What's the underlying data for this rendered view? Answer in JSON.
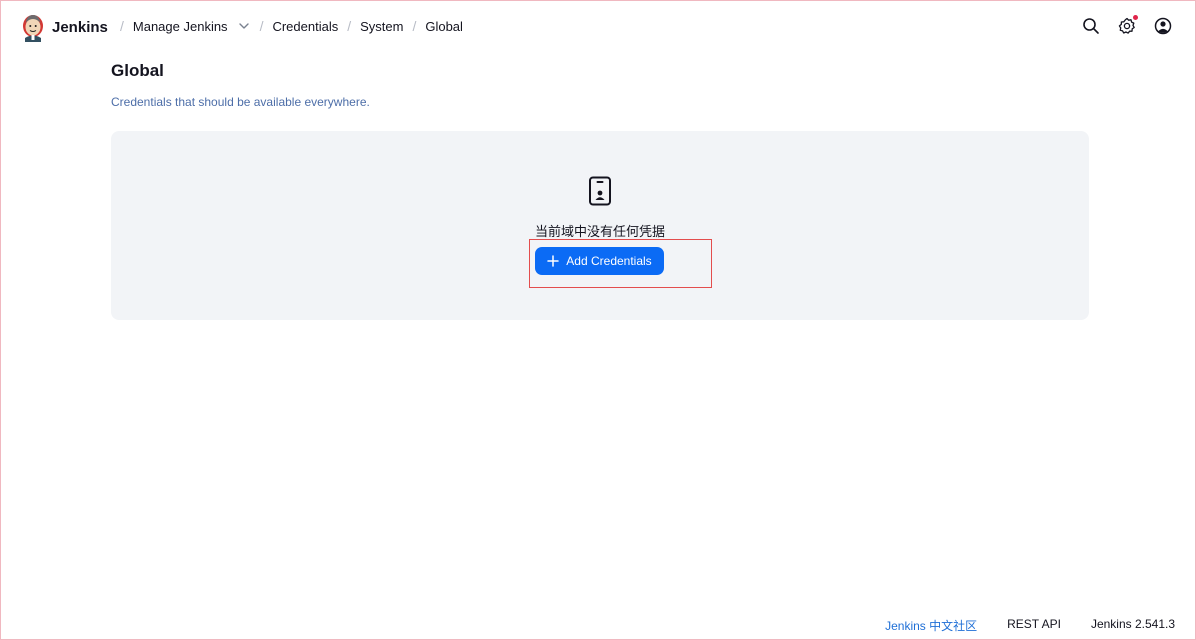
{
  "header": {
    "brand": "Jenkins",
    "breadcrumbs": [
      {
        "label": "Manage Jenkins"
      },
      {
        "label": "Credentials"
      },
      {
        "label": "System"
      },
      {
        "label": "Global"
      }
    ],
    "icons": [
      "search-icon",
      "settings-icon",
      "account-icon"
    ],
    "settings_has_notification": true
  },
  "main": {
    "title": "Global",
    "description": "Credentials that should be available everywhere.",
    "empty_state": {
      "icon": "credential-card-icon",
      "message": "当前域中没有任何凭据",
      "button_label": "Add Credentials"
    }
  },
  "footer": {
    "links": [
      {
        "label": "Jenkins 中文社区"
      },
      {
        "label": "REST API"
      },
      {
        "label": "Jenkins 2.541.3"
      }
    ]
  },
  "colors": {
    "accent": "#0b6bf5",
    "panel_bg": "#f2f4f7",
    "description_text": "#4d6ea8",
    "highlight": "#e34d4d"
  }
}
